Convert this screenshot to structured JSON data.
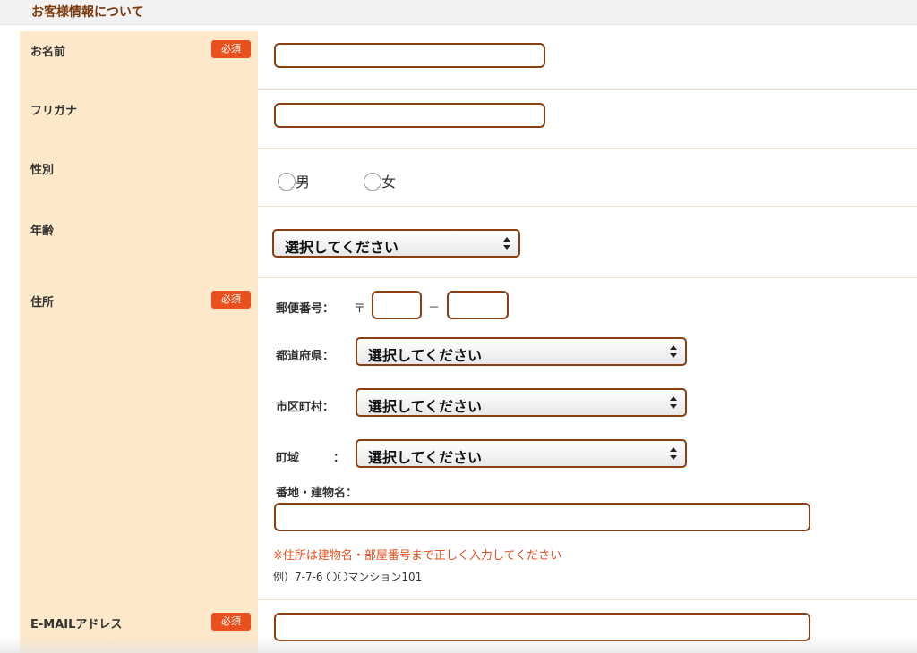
{
  "section": {
    "title": "お客様情報について"
  },
  "required_badge": "必須",
  "fields": {
    "name": {
      "label": "お名前",
      "value": ""
    },
    "furigana": {
      "label": "フリガナ",
      "value": ""
    },
    "gender": {
      "label": "性別",
      "options": [
        "男",
        "女"
      ]
    },
    "age": {
      "label": "年齢",
      "selected": "選択してください"
    },
    "address": {
      "label": "住所",
      "postal_label": "郵便番号：",
      "postal_mark": "〒",
      "postal_sep": "－",
      "postal_1": "",
      "postal_2": "",
      "prefecture_label": "都道府県：",
      "prefecture_selected": "選択してください",
      "city_label": "市区町村：",
      "city_selected": "選択してください",
      "town_label": "町域",
      "town_colon": "：",
      "town_selected": "選択してください",
      "street_label": "番地・建物名：",
      "street_value": "",
      "note_red": "※住所は建物名・部屋番号まで正しく入力してください",
      "example": "例）7-7-6 〇〇マンション101"
    },
    "email": {
      "label": "E-MAILアドレス",
      "value": ""
    }
  },
  "colors": {
    "label_bg": "#fde9c9",
    "required_bg": "#e8501e",
    "input_border": "#8a3f10",
    "header_text": "#7a3a0c"
  }
}
